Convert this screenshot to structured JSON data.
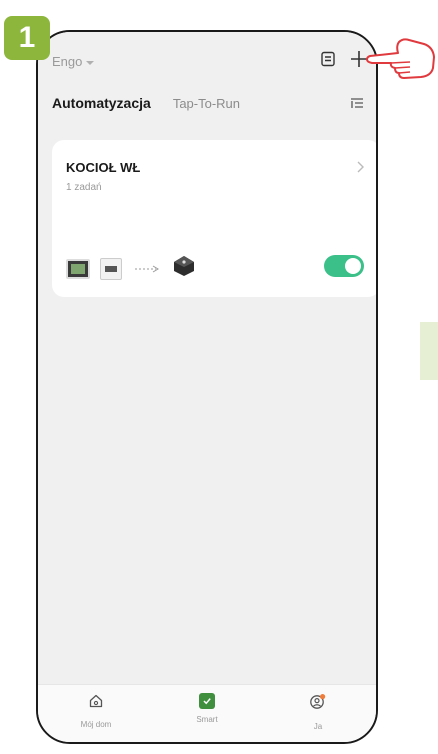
{
  "step_badge": "1",
  "header": {
    "home_name": "Engo"
  },
  "tabs": [
    {
      "label": "Automatyzacja"
    },
    {
      "label": "Tap-To-Run"
    }
  ],
  "automation": {
    "title": "KOCIOŁ WŁ",
    "subtitle": "1 zadań",
    "enabled": true
  },
  "bottom_nav": [
    {
      "label": "Mój dom",
      "icon": "home-icon"
    },
    {
      "label": "Smart",
      "icon": "smart-icon"
    },
    {
      "label": "Ja",
      "icon": "profile-icon"
    }
  ],
  "colors": {
    "badge": "#8cb63c",
    "toggle_on": "#3cc08a",
    "smart_active": "#3f8f3f"
  }
}
